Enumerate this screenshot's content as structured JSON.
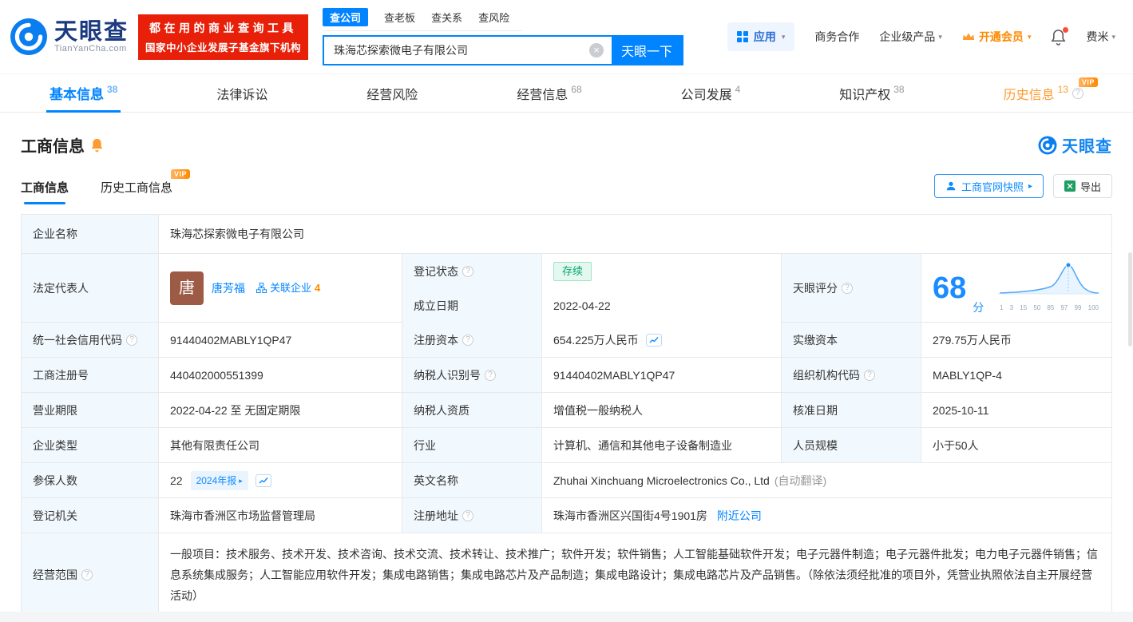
{
  "brand": {
    "name": "天眼查",
    "domain": "TianYanCha.com",
    "accent_color": "#0084ff",
    "banner_line1": "都在用的商业查询工具",
    "banner_line2": "国家中小企业发展子基金旗下机构"
  },
  "icons": {
    "clear": "×",
    "caret": "▾",
    "arrow": "▸",
    "help": "?"
  },
  "search": {
    "tabs": [
      {
        "label": "查公司",
        "active": true
      },
      {
        "label": "查老板",
        "active": false
      },
      {
        "label": "查关系",
        "active": false
      },
      {
        "label": "查风险",
        "active": false
      }
    ],
    "value": "珠海芯探索微电子有限公司",
    "button": "天眼一下"
  },
  "topnav": {
    "apps": "应用",
    "cooperation": "商务合作",
    "enterprise": "企业级产品",
    "vip": "开通会员",
    "user": "费米"
  },
  "tabs": [
    {
      "label": "基本信息",
      "count": "38"
    },
    {
      "label": "法律诉讼",
      "count": ""
    },
    {
      "label": "经营风险",
      "count": ""
    },
    {
      "label": "经营信息",
      "count": "68"
    },
    {
      "label": "公司发展",
      "count": "4"
    },
    {
      "label": "知识产权",
      "count": "38"
    },
    {
      "label": "历史信息",
      "count": "13"
    }
  ],
  "section": {
    "title": "工商信息",
    "subtab_active": "工商信息",
    "subtab_history": "历史工商信息",
    "vip_badge": "VIP",
    "snapshot_button": "工商官网快照",
    "export_button": "导出"
  },
  "info": {
    "company_name_label": "企业名称",
    "company_name": "珠海芯探索微电子有限公司",
    "legal_rep_label": "法定代表人",
    "legal_rep_avatar": "唐",
    "legal_rep_name": "唐芳福",
    "related_label": "关联企业",
    "related_count": "4",
    "reg_status_label": "登记状态",
    "reg_status": "存续",
    "establish_label": "成立日期",
    "establish_date": "2022-04-22",
    "score_label": "天眼评分",
    "score_value": "68",
    "score_unit": "分",
    "score_ticks": [
      "1",
      "3",
      "15",
      "50",
      "85",
      "97",
      "99",
      "100"
    ],
    "credit_code_label": "统一社会信用代码",
    "credit_code": "91440402MABLY1QP47",
    "reg_capital_label": "注册资本",
    "reg_capital": "654.225万人民币",
    "paid_capital_label": "实缴资本",
    "paid_capital": "279.75万人民币",
    "reg_number_label": "工商注册号",
    "reg_number": "440402000551399",
    "taxpayer_id_label": "纳税人识别号",
    "taxpayer_id": "91440402MABLY1QP47",
    "org_code_label": "组织机构代码",
    "org_code": "MABLY1QP-4",
    "business_term_label": "营业期限",
    "business_term": "2022-04-22 至 无固定期限",
    "taxpayer_quality_label": "纳税人资质",
    "taxpayer_quality": "增值税一般纳税人",
    "approval_date_label": "核准日期",
    "approval_date": "2025-10-11",
    "company_type_label": "企业类型",
    "company_type": "其他有限责任公司",
    "industry_label": "行业",
    "industry": "计算机、通信和其他电子设备制造业",
    "staff_size_label": "人员规模",
    "staff_size": "小于50人",
    "insured_label": "参保人数",
    "insured_count": "22",
    "annual_report_badge": "2024年报",
    "english_name_label": "英文名称",
    "english_name": "Zhuhai Xinchuang Microelectronics Co., Ltd",
    "auto_translate": "(自动翻译)",
    "reg_authority_label": "登记机关",
    "reg_authority": "珠海市香洲区市场监督管理局",
    "address_label": "注册地址",
    "address": "珠海市香洲区兴国街4号1901房",
    "nearby_link": "附近公司",
    "business_scope_label": "经营范围",
    "business_scope": "一般项目：技术服务、技术开发、技术咨询、技术交流、技术转让、技术推广；软件开发；软件销售；人工智能基础软件开发；电子元器件制造；电子元器件批发；电力电子元器件销售；信息系统集成服务；人工智能应用软件开发；集成电路销售；集成电路芯片及产品制造；集成电路设计；集成电路芯片及产品销售。（除依法须经批准的项目外，凭营业执照依法自主开展经营活动）"
  }
}
